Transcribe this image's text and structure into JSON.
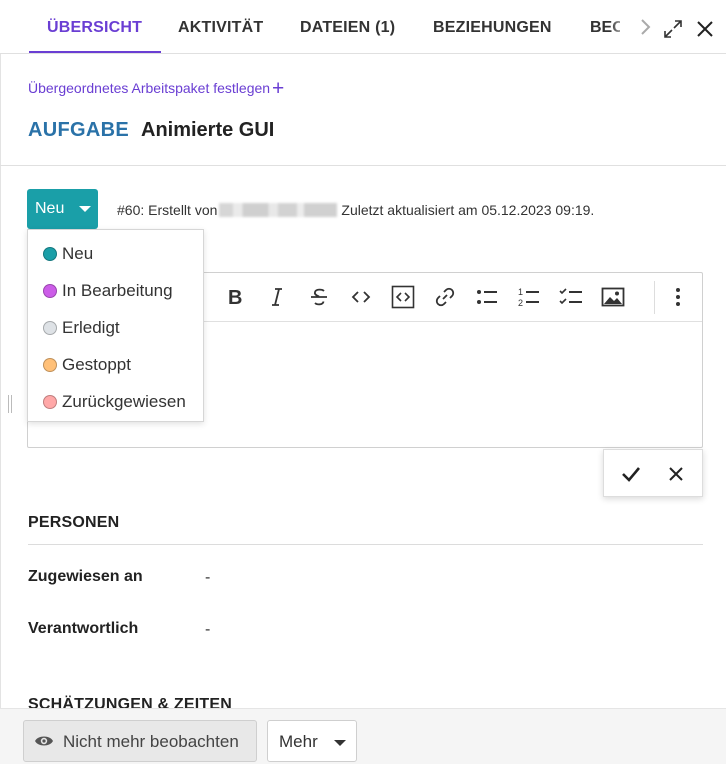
{
  "tabs": [
    {
      "label": "ÜBERSICHT",
      "active": true
    },
    {
      "label": "AKTIVITÄT",
      "active": false
    },
    {
      "label": "DATEIEN (1)",
      "active": false
    },
    {
      "label": "BEZIEHUNGEN",
      "active": false
    },
    {
      "label": "BEOBACHTER",
      "active": false
    }
  ],
  "header": {
    "parent_link": "Übergeordnetes Arbeitspaket festlegen",
    "type": "AUFGABE",
    "title": "Animierte GUI"
  },
  "status": {
    "current": "Neu",
    "meta_prefix": "#60: Erstellt von",
    "meta_suffix": "Zuletzt aktualisiert am 05.12.2023 09:19.",
    "options": [
      {
        "label": "Neu",
        "color": "#1a9fa8"
      },
      {
        "label": "In Bearbeitung",
        "color": "#cc5de8"
      },
      {
        "label": "Erledigt",
        "color": "#dee2e6"
      },
      {
        "label": "Gestoppt",
        "color": "#ffc078"
      },
      {
        "label": "Zurückgewiesen",
        "color": "#ffa8a8"
      }
    ]
  },
  "toolbar_icons": [
    "bold-icon",
    "italic-icon",
    "strikethrough-icon",
    "code-icon",
    "code-block-icon",
    "link-icon",
    "bulleted-list-icon",
    "numbered-list-icon",
    "todo-list-icon",
    "image-icon",
    "more-vertical-icon"
  ],
  "sections": {
    "personen": {
      "title": "PERSONEN",
      "fields": [
        {
          "label": "Zugewiesen an",
          "value": "-"
        },
        {
          "label": "Verantwortlich",
          "value": "-"
        }
      ]
    },
    "estimates_title": "SCHÄTZUNGEN & ZEITEN"
  },
  "footer": {
    "watch_label": "Nicht mehr beobachten",
    "more_label": "Mehr"
  },
  "colors": {
    "accent": "#6a3ed3",
    "type": "#2a72a8",
    "status": "#1a9fa8"
  }
}
